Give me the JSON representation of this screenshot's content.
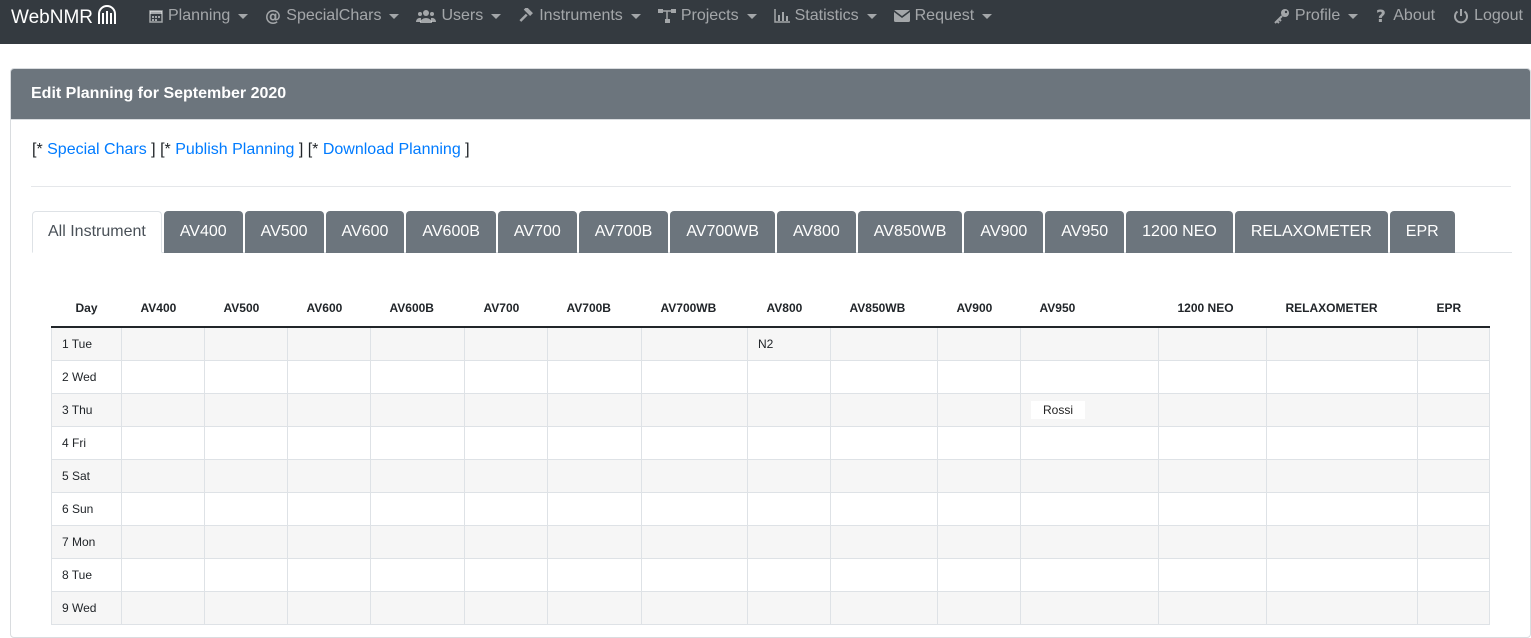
{
  "navbar": {
    "brand": "WebNMR",
    "left_items": [
      {
        "label": "Planning",
        "icon": "calendar-icon"
      },
      {
        "label": "SpecialChars",
        "icon": "at-icon"
      },
      {
        "label": "Users",
        "icon": "users-icon"
      },
      {
        "label": "Instruments",
        "icon": "hammer-icon"
      },
      {
        "label": "Projects",
        "icon": "sitemap-icon"
      },
      {
        "label": "Statistics",
        "icon": "chart-icon"
      },
      {
        "label": "Request",
        "icon": "envelope-icon"
      }
    ],
    "right_items": [
      {
        "label": "Profile",
        "icon": "key-icon"
      },
      {
        "label": "About",
        "icon": "question-icon"
      },
      {
        "label": "Logout",
        "icon": "power-icon"
      }
    ]
  },
  "card": {
    "title": "Edit Planning for September 2020",
    "links": [
      {
        "prefix": "[* ",
        "label": "Special Chars",
        "suffix": " ]"
      },
      {
        "prefix": " [* ",
        "label": "Publish Planning",
        "suffix": " ]"
      },
      {
        "prefix": " [* ",
        "label": "Download Planning",
        "suffix": " ]"
      }
    ]
  },
  "tabs": [
    "All Instrument",
    "AV400",
    "AV500",
    "AV600",
    "AV600B",
    "AV700",
    "AV700B",
    "AV700WB",
    "AV800",
    "AV850WB",
    "AV900",
    "AV950",
    "1200 NEO",
    "RELAXOMETER",
    "EPR"
  ],
  "active_tab": 0,
  "table": {
    "headers": [
      "Day",
      "AV400",
      "AV500",
      "AV600",
      "AV600B",
      "AV700",
      "AV700B",
      "AV700WB",
      "AV800",
      "AV850WB",
      "AV900",
      "AV950",
      "1200 NEO",
      "RELAXOMETER",
      "EPR"
    ],
    "rows": [
      {
        "day": "1 Tue",
        "cells": [
          "",
          "",
          "",
          "",
          "",
          "",
          "",
          "N2",
          "",
          "",
          "",
          "",
          "",
          ""
        ]
      },
      {
        "day": "2 Wed",
        "cells": [
          "",
          "",
          "",
          "",
          "",
          "",
          "",
          "",
          "",
          "",
          "",
          "",
          "",
          ""
        ]
      },
      {
        "day": "3 Thu",
        "cells": [
          "",
          "",
          "",
          "",
          "",
          "",
          "",
          "",
          "",
          "",
          "Rossi",
          "",
          "",
          ""
        ]
      },
      {
        "day": "4 Fri",
        "cells": [
          "",
          "",
          "",
          "",
          "",
          "",
          "",
          "",
          "",
          "",
          "",
          "",
          "",
          ""
        ]
      },
      {
        "day": "5 Sat",
        "cells": [
          "",
          "",
          "",
          "",
          "",
          "",
          "",
          "",
          "",
          "",
          "",
          "",
          "",
          ""
        ]
      },
      {
        "day": "6 Sun",
        "cells": [
          "",
          "",
          "",
          "",
          "",
          "",
          "",
          "",
          "",
          "",
          "",
          "",
          "",
          ""
        ]
      },
      {
        "day": "7 Mon",
        "cells": [
          "",
          "",
          "",
          "",
          "",
          "",
          "",
          "",
          "",
          "",
          "",
          "",
          "",
          ""
        ]
      },
      {
        "day": "8 Tue",
        "cells": [
          "",
          "",
          "",
          "",
          "",
          "",
          "",
          "",
          "",
          "",
          "",
          "",
          "",
          ""
        ]
      },
      {
        "day": "9 Wed",
        "cells": [
          "",
          "",
          "",
          "",
          "",
          "",
          "",
          "",
          "",
          "",
          "",
          "",
          "",
          ""
        ]
      }
    ]
  },
  "colors": {
    "navbar_bg": "#343a40",
    "card_header_bg": "#6c757d",
    "link": "#007bff",
    "tab_bg": "#6c757d"
  }
}
